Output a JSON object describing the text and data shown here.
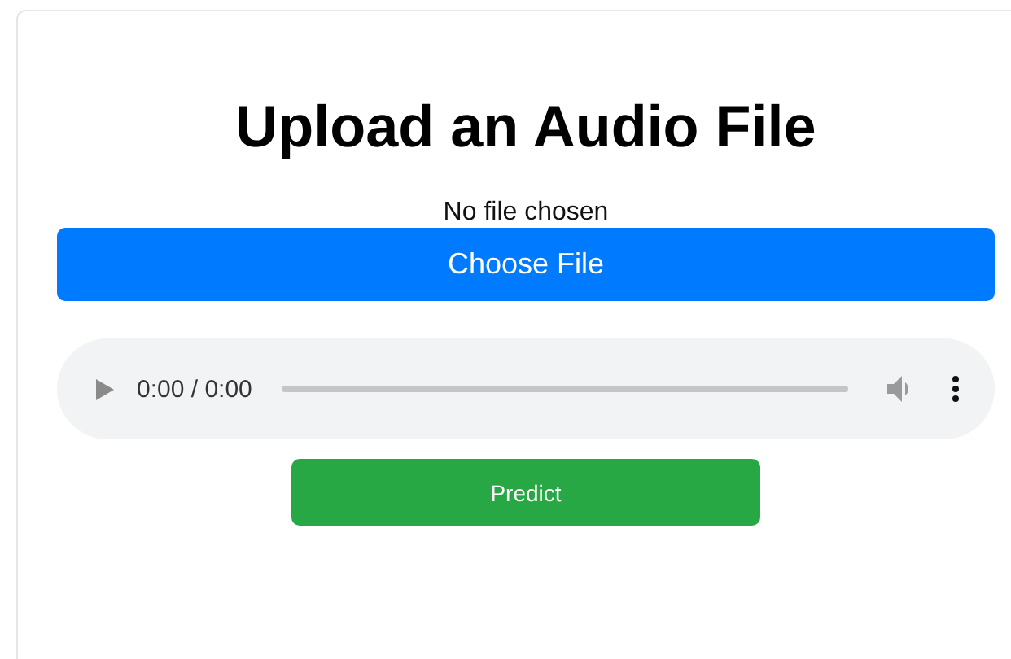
{
  "title": "Upload an Audio File",
  "file_input": {
    "status": "No file chosen",
    "button": "Choose File"
  },
  "audio_player": {
    "time": "0:00 / 0:00"
  },
  "predict_button": "Predict"
}
